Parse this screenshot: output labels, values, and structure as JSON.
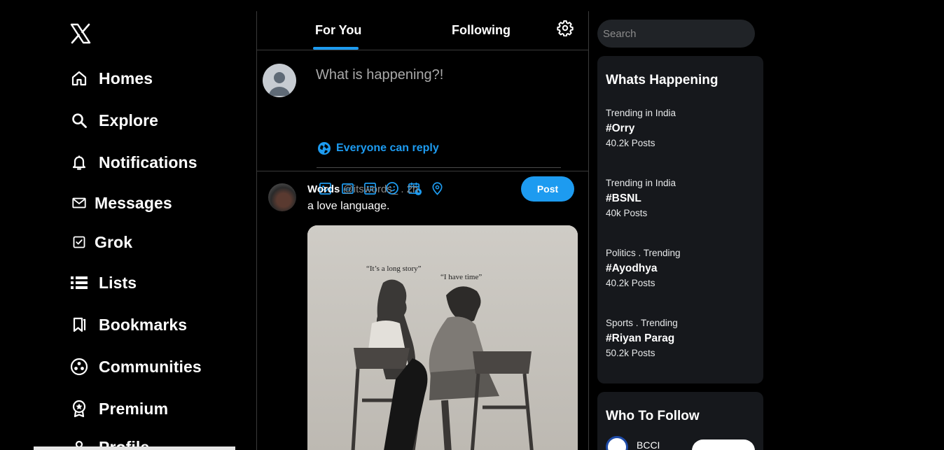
{
  "sidebar": {
    "logo": "x-logo-icon",
    "items": [
      {
        "label": "Homes",
        "icon": "home-icon"
      },
      {
        "label": "Explore",
        "icon": "search-icon"
      },
      {
        "label": "Notifications",
        "icon": "bell-icon"
      },
      {
        "label": "Messages",
        "icon": "envelope-icon"
      },
      {
        "label": "Grok",
        "icon": "grok-icon"
      },
      {
        "label": "Lists",
        "icon": "list-icon"
      },
      {
        "label": "Bookmarks",
        "icon": "bookmark-icon"
      },
      {
        "label": "Communities",
        "icon": "communities-icon"
      },
      {
        "label": "Premium",
        "icon": "premium-icon"
      },
      {
        "label": "Profile",
        "icon": "profile-icon"
      }
    ]
  },
  "feed": {
    "tabs": [
      {
        "label": "For You",
        "active": true
      },
      {
        "label": "Following",
        "active": false
      }
    ],
    "composer": {
      "placeholder": "What is happening?!",
      "reply_setting": "Everyone can reply",
      "post_label": "Post",
      "tools": [
        "image-icon",
        "gif-icon",
        "poll-icon",
        "emoji-icon",
        "schedule-icon",
        "location-icon"
      ]
    },
    "tweet": {
      "author": "Words",
      "meta": "@itswords_ . 2h",
      "text": "a love language.",
      "media_captions": [
        "“It’s a long story”",
        "“I have time”"
      ]
    }
  },
  "right": {
    "search_placeholder": "Search",
    "happening": {
      "title": "Whats Happening",
      "trends": [
        {
          "context": "Trending in India",
          "tag": "#Orry",
          "count": "40.2k Posts"
        },
        {
          "context": "Trending in India",
          "tag": "#BSNL",
          "count": "40k Posts"
        },
        {
          "context": "Politics . Trending",
          "tag": "#Ayodhya",
          "count": "40.2k Posts"
        },
        {
          "context": "Sports . Trending",
          "tag": "#Riyan Parag",
          "count": "50.2k Posts"
        }
      ]
    },
    "follow": {
      "title": "Who To Follow",
      "name": "BCCI"
    }
  },
  "colors": {
    "accent": "#1d9bf0",
    "background": "#000000",
    "panel": "#16181c"
  }
}
